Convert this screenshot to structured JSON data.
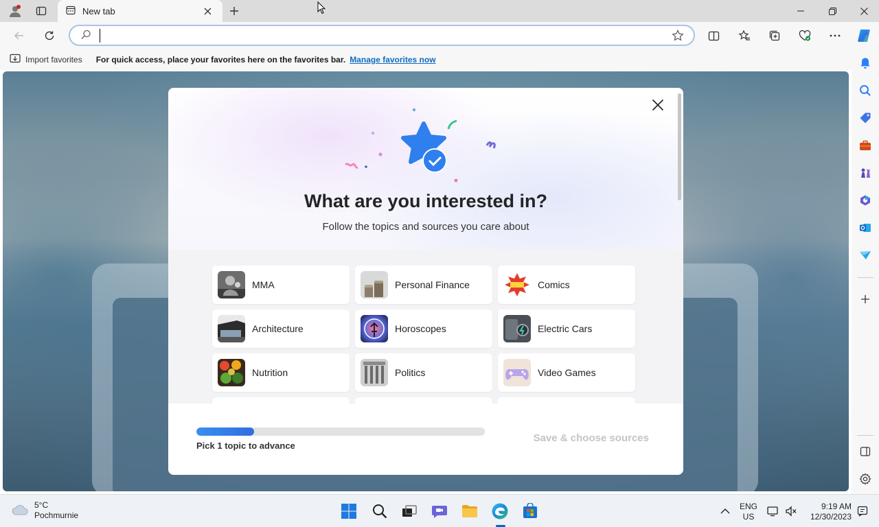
{
  "browser": {
    "tab_title": "New tab",
    "address_value": "",
    "favorites_bar": {
      "import_label": "Import favorites",
      "message": "For quick access, place your favorites here on the favorites bar.",
      "link": "Manage favorites now"
    }
  },
  "modal": {
    "title": "What are you interested in?",
    "subtitle": "Follow the topics and sources you care about",
    "topics": [
      {
        "label": "MMA",
        "icon": "mma-thumb"
      },
      {
        "label": "Personal Finance",
        "icon": "coins-thumb"
      },
      {
        "label": "Comics",
        "icon": "comics-thumb"
      },
      {
        "label": "Architecture",
        "icon": "architecture-thumb"
      },
      {
        "label": "Horoscopes",
        "icon": "horoscope-thumb"
      },
      {
        "label": "Electric Cars",
        "icon": "electric-car-thumb"
      },
      {
        "label": "Nutrition",
        "icon": "nutrition-thumb"
      },
      {
        "label": "Politics",
        "icon": "politics-thumb"
      },
      {
        "label": "Video Games",
        "icon": "gamepad-thumb"
      }
    ],
    "progress_fraction": 0.2,
    "progress_label": "Pick 1 topic to advance",
    "save_button": "Save & choose sources"
  },
  "taskbar": {
    "weather_temp": "5°C",
    "weather_desc": "Pochmurnie",
    "lang_top": "ENG",
    "lang_bottom": "US",
    "time": "9:19 AM",
    "date": "12/30/2023"
  },
  "colors": {
    "accent": "#0f6cbd",
    "progress": "#3a8ef0",
    "star": "#2f7fee"
  }
}
